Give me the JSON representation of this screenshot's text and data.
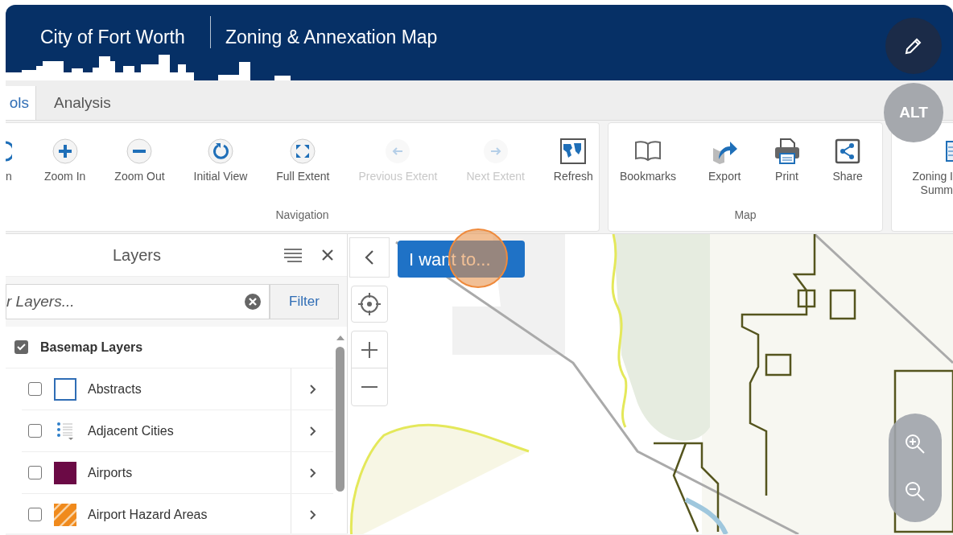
{
  "header": {
    "city": "City of Fort Worth",
    "title": "Zoning & Annexation Map"
  },
  "alt_badge": {
    "label": "ALT"
  },
  "tabs": [
    {
      "label": "ols",
      "selected": true
    },
    {
      "label": "Analysis",
      "selected": false
    }
  ],
  "ribbon": {
    "groups": [
      {
        "label": "Navigation",
        "items": [
          {
            "kind": "partial",
            "label": "n",
            "disabled": false
          },
          {
            "kind": "zoomin",
            "label": "Zoom In",
            "disabled": false
          },
          {
            "kind": "zoomout",
            "label": "Zoom Out",
            "disabled": false
          },
          {
            "kind": "reset",
            "label": "Initial View",
            "disabled": false
          },
          {
            "kind": "extent",
            "label": "Full Extent",
            "disabled": false
          },
          {
            "kind": "back",
            "label": "Previous Extent",
            "disabled": true
          },
          {
            "kind": "forward",
            "label": "Next Extent",
            "disabled": true
          },
          {
            "kind": "refresh",
            "label": "Refresh",
            "disabled": false
          }
        ]
      },
      {
        "label": "Map",
        "items": [
          {
            "kind": "bookmarks",
            "label": "Bookmarks",
            "disabled": false
          },
          {
            "kind": "export",
            "label": "Export",
            "disabled": false
          },
          {
            "kind": "print",
            "label": "Print",
            "disabled": false
          },
          {
            "kind": "share",
            "label": "Share",
            "disabled": false
          }
        ]
      },
      {
        "items": [
          {
            "kind": "report",
            "lines": [
              "Zoning I",
              "Summ"
            ],
            "disabled": false
          }
        ]
      }
    ]
  },
  "layers_panel": {
    "title": "Layers",
    "filter": {
      "placeholder": "r Layers...",
      "button": "Filter"
    },
    "tree": [
      {
        "label": "Basemap Layers",
        "checked": true,
        "children": [
          {
            "label": "Abstracts",
            "checked": false,
            "kind": "outline",
            "color": "#2f6db5"
          },
          {
            "label": "Adjacent Cities",
            "checked": false,
            "kind": "list"
          },
          {
            "label": "Airports",
            "checked": false,
            "kind": "fill",
            "color": "#6b0a45"
          },
          {
            "label": "Airport Hazard Areas",
            "checked": false,
            "kind": "hatch",
            "color": "#f08a1c"
          }
        ]
      }
    ]
  },
  "map": {
    "menu_button": "I want to..."
  }
}
